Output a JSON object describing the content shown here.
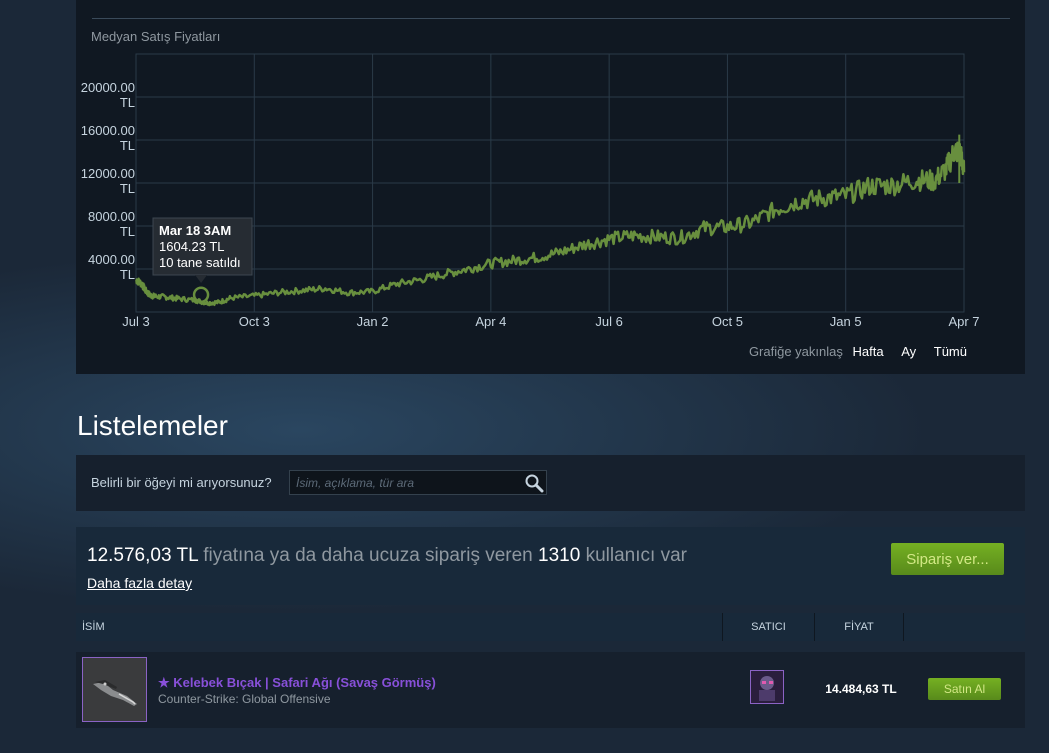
{
  "chart": {
    "title": "Medyan Satış Fiyatları",
    "tooltip": {
      "date": "Mar 18 3AM",
      "price": "1604.23 TL",
      "sold": "10 tane satıldı"
    }
  },
  "chart_data": {
    "type": "line",
    "title": "Medyan Satış Fiyatları",
    "xlabel": "",
    "ylabel": "",
    "x_ticks": [
      "Jul 3",
      "Oct 3",
      "Jan 2",
      "Apr 4",
      "Jul 6",
      "Oct 5",
      "Jan 5",
      "Apr 7"
    ],
    "y_ticks": [
      "4000.00 TL",
      "8000.00 TL",
      "12000.00 TL",
      "16000.00 TL",
      "20000.00 TL"
    ],
    "ylim": [
      0,
      24000
    ],
    "grid": true,
    "color": "#688f3e",
    "series": [
      {
        "values": [
          [
            0,
            3000
          ],
          [
            0.05,
            2600
          ],
          [
            0.08,
            2000
          ],
          [
            0.12,
            1550
          ],
          [
            0.16,
            1450
          ],
          [
            0.25,
            1400
          ],
          [
            0.35,
            1250
          ],
          [
            0.5,
            1100
          ],
          [
            0.6,
            850
          ],
          [
            0.7,
            900
          ],
          [
            0.8,
            1300
          ],
          [
            1.0,
            1500
          ],
          [
            1.2,
            1800
          ],
          [
            1.4,
            2000
          ],
          [
            1.6,
            2200
          ],
          [
            1.8,
            1800
          ],
          [
            2.0,
            1900
          ],
          [
            2.2,
            2600
          ],
          [
            2.4,
            3000
          ],
          [
            2.6,
            3500
          ],
          [
            2.8,
            4000
          ],
          [
            3.0,
            4500
          ],
          [
            3.2,
            4800
          ],
          [
            3.4,
            5100
          ],
          [
            3.6,
            5600
          ],
          [
            3.8,
            6300
          ],
          [
            4.0,
            6800
          ],
          [
            4.2,
            7100
          ],
          [
            4.4,
            7000
          ],
          [
            4.6,
            6900
          ],
          [
            4.8,
            7800
          ],
          [
            5.0,
            7900
          ],
          [
            5.2,
            8300
          ],
          [
            5.4,
            9500
          ],
          [
            5.6,
            10300
          ],
          [
            5.8,
            10600
          ],
          [
            6.0,
            10800
          ],
          [
            6.2,
            11700
          ],
          [
            6.4,
            11800
          ],
          [
            6.6,
            12300
          ],
          [
            6.75,
            12200
          ],
          [
            6.85,
            13300
          ],
          [
            6.92,
            15000
          ],
          [
            6.97,
            14800
          ],
          [
            7.0,
            13000
          ]
        ]
      }
    ],
    "tooltip_point": {
      "x": 0.55,
      "y": 1604.23,
      "label": "Mar 18 3AM"
    }
  },
  "zoom": {
    "label": "Grafiğe yakınlaş",
    "options": [
      "Hafta",
      "Ay",
      "Tümü"
    ]
  },
  "listings": {
    "heading": "Listelemeler",
    "search_label": "Belirli bir öğeyi mi arıyorsunuz?",
    "search_placeholder": "İsim, açıklama, tür ara"
  },
  "buy_order": {
    "price": "12.576,03 TL",
    "middle": " fiyatına ya da daha ucuza sipariş veren ",
    "count": "1310",
    "suffix": " kullanıcı var",
    "detail_link": "Daha fazla detay",
    "button": "Sipariş ver..."
  },
  "table": {
    "col_name": "İSİM",
    "col_seller": "SATICI",
    "col_price": "FİYAT"
  },
  "item": {
    "name": "★ Kelebek Bıçak | Safari Ağı (Savaş Görmüş)",
    "game": "Counter-Strike: Global Offensive",
    "price": "14.484,63 TL",
    "buy_button": "Satın Al"
  },
  "colors": {
    "accent_green": "#75b022",
    "rarity_purple": "#8850d9",
    "chart_line": "#688f3e"
  }
}
